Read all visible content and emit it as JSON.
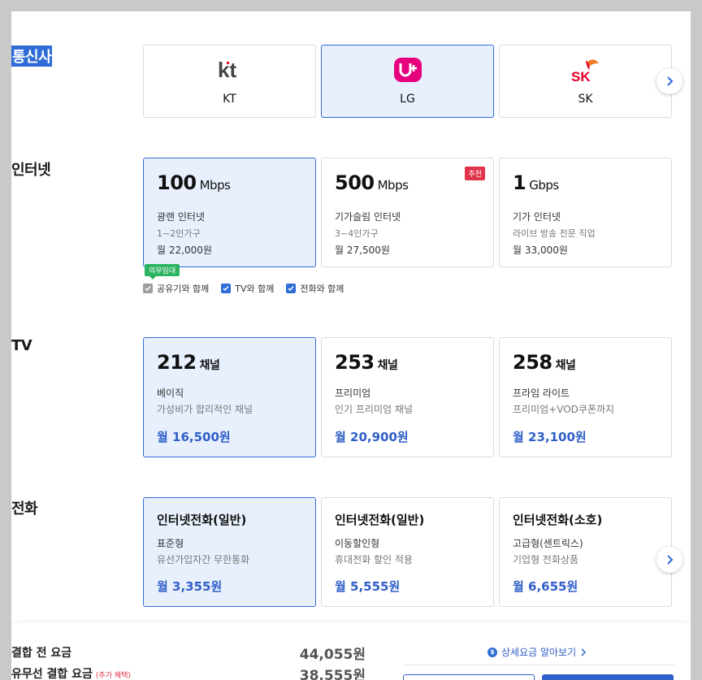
{
  "sections": {
    "carrier": "통신사",
    "internet": "인터넷",
    "tv": "TV",
    "phone": "전화"
  },
  "carriers": [
    {
      "label": "KT",
      "logo_text": "kt"
    },
    {
      "label": "LG",
      "logo_text": "U+"
    },
    {
      "label": "SK",
      "logo_text": "SK"
    }
  ],
  "internet": [
    {
      "speed": "100",
      "unit": "Mbps",
      "type": "광랜 인터넷",
      "household": "1~2인가구",
      "price": "월 22,000원"
    },
    {
      "speed": "500",
      "unit": "Mbps",
      "type": "기가슬림 인터넷",
      "household": "3~4인가구",
      "price": "월 27,500원",
      "badge": "추천"
    },
    {
      "speed": "1",
      "unit": "Gbps",
      "type": "기가 인터넷",
      "household": "라이브 방송 전문 직업",
      "price": "월 33,000원"
    }
  ],
  "options": {
    "badge": "의무임대",
    "items": [
      {
        "label": "공유기와 함께",
        "checked": true,
        "disabled": true
      },
      {
        "label": "TV와 함께",
        "checked": true,
        "disabled": false
      },
      {
        "label": "전화와 함께",
        "checked": true,
        "disabled": false
      }
    ]
  },
  "tv": [
    {
      "channels": "212",
      "unit": "채널",
      "name": "베이직",
      "desc": "가성비가 합리적인 채널",
      "price": "월 16,500원"
    },
    {
      "channels": "253",
      "unit": "채널",
      "name": "프리미엄",
      "desc": "인기 프리미엄 채널",
      "price": "월 20,900원"
    },
    {
      "channels": "258",
      "unit": "채널",
      "name": "프라임 라이트",
      "desc": "프리미엄+VOD쿠폰까지",
      "price": "월 23,100원"
    }
  ],
  "phone": [
    {
      "name": "인터넷전화(일반)",
      "type": "표준형",
      "desc": "유선가입자간 무한통화",
      "price": "월 3,355원"
    },
    {
      "name": "인터넷전화(일반)",
      "type": "이동할인형",
      "desc": "휴대전화 할인 적용",
      "price": "월 5,555원"
    },
    {
      "name": "인터넷전화(소호)",
      "type": "고급형(센트릭스)",
      "desc": "기업형 전화상품",
      "price": "월 6,655원"
    }
  ],
  "footer": {
    "before_label": "결합 전 요금",
    "before_value": "44,055원",
    "after_label": "유무선 결합 요금",
    "after_extra": "(추가 혜택)",
    "after_value": "38,555원",
    "detail_link": "상세요금 알아보기"
  },
  "colors": {
    "accent": "#2f6cd6",
    "price": "#2f5fc8",
    "badge_red": "#e0344a",
    "badge_green": "#2cb35f",
    "lg_magenta": "#e6007e",
    "sk_red": "#e4002b",
    "sk_orange": "#f47725"
  }
}
